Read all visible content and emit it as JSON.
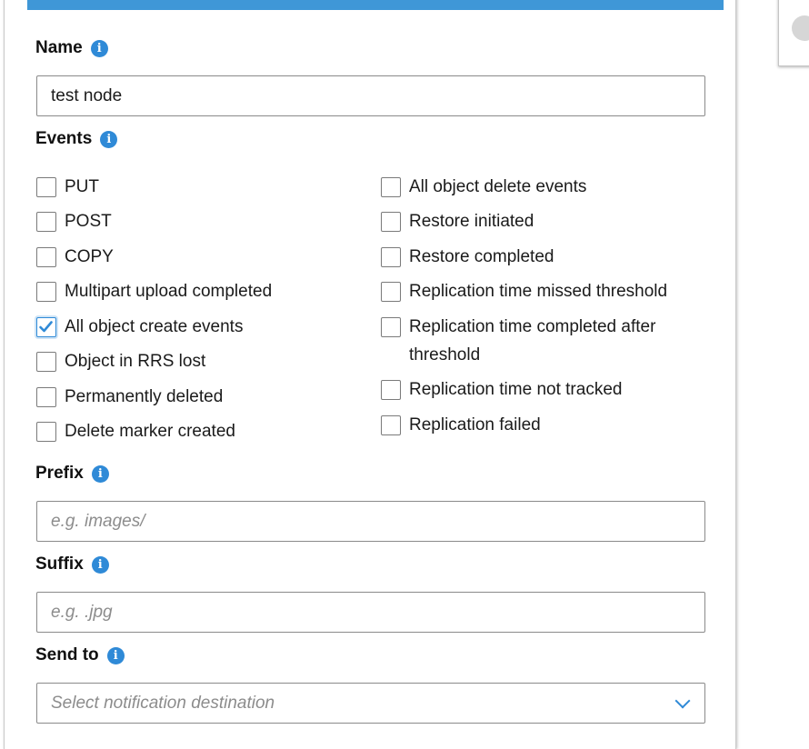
{
  "form": {
    "name": {
      "label": "Name",
      "value": "test node"
    },
    "events": {
      "label": "Events",
      "left": [
        {
          "label": "PUT",
          "checked": false
        },
        {
          "label": "POST",
          "checked": false
        },
        {
          "label": "COPY",
          "checked": false
        },
        {
          "label": "Multipart upload completed",
          "checked": false
        },
        {
          "label": "All object create events",
          "checked": true
        },
        {
          "label": "Object in RRS lost",
          "checked": false
        },
        {
          "label": "Permanently deleted",
          "checked": false
        },
        {
          "label": "Delete marker created",
          "checked": false
        }
      ],
      "right": [
        {
          "label": "All object delete events",
          "checked": false
        },
        {
          "label": "Restore initiated",
          "checked": false
        },
        {
          "label": "Restore completed",
          "checked": false
        },
        {
          "label": "Replication time missed threshold",
          "checked": false
        },
        {
          "label": "Replication time completed after threshold",
          "checked": false
        },
        {
          "label": "Replication time not tracked",
          "checked": false
        },
        {
          "label": "Replication failed",
          "checked": false
        }
      ]
    },
    "prefix": {
      "label": "Prefix",
      "placeholder": "e.g. images/"
    },
    "suffix": {
      "label": "Suffix",
      "placeholder": "e.g. .jpg"
    },
    "send_to": {
      "label": "Send to",
      "placeholder": "Select notification destination"
    }
  },
  "icons": {
    "info": "info-icon",
    "chevron": "chevron-down-icon",
    "check": "check-icon"
  },
  "colors": {
    "accent": "#3f97d7",
    "icon_blue": "#2f8ad7",
    "border": "#8a8a8a",
    "placeholder": "#8c8c8c"
  }
}
